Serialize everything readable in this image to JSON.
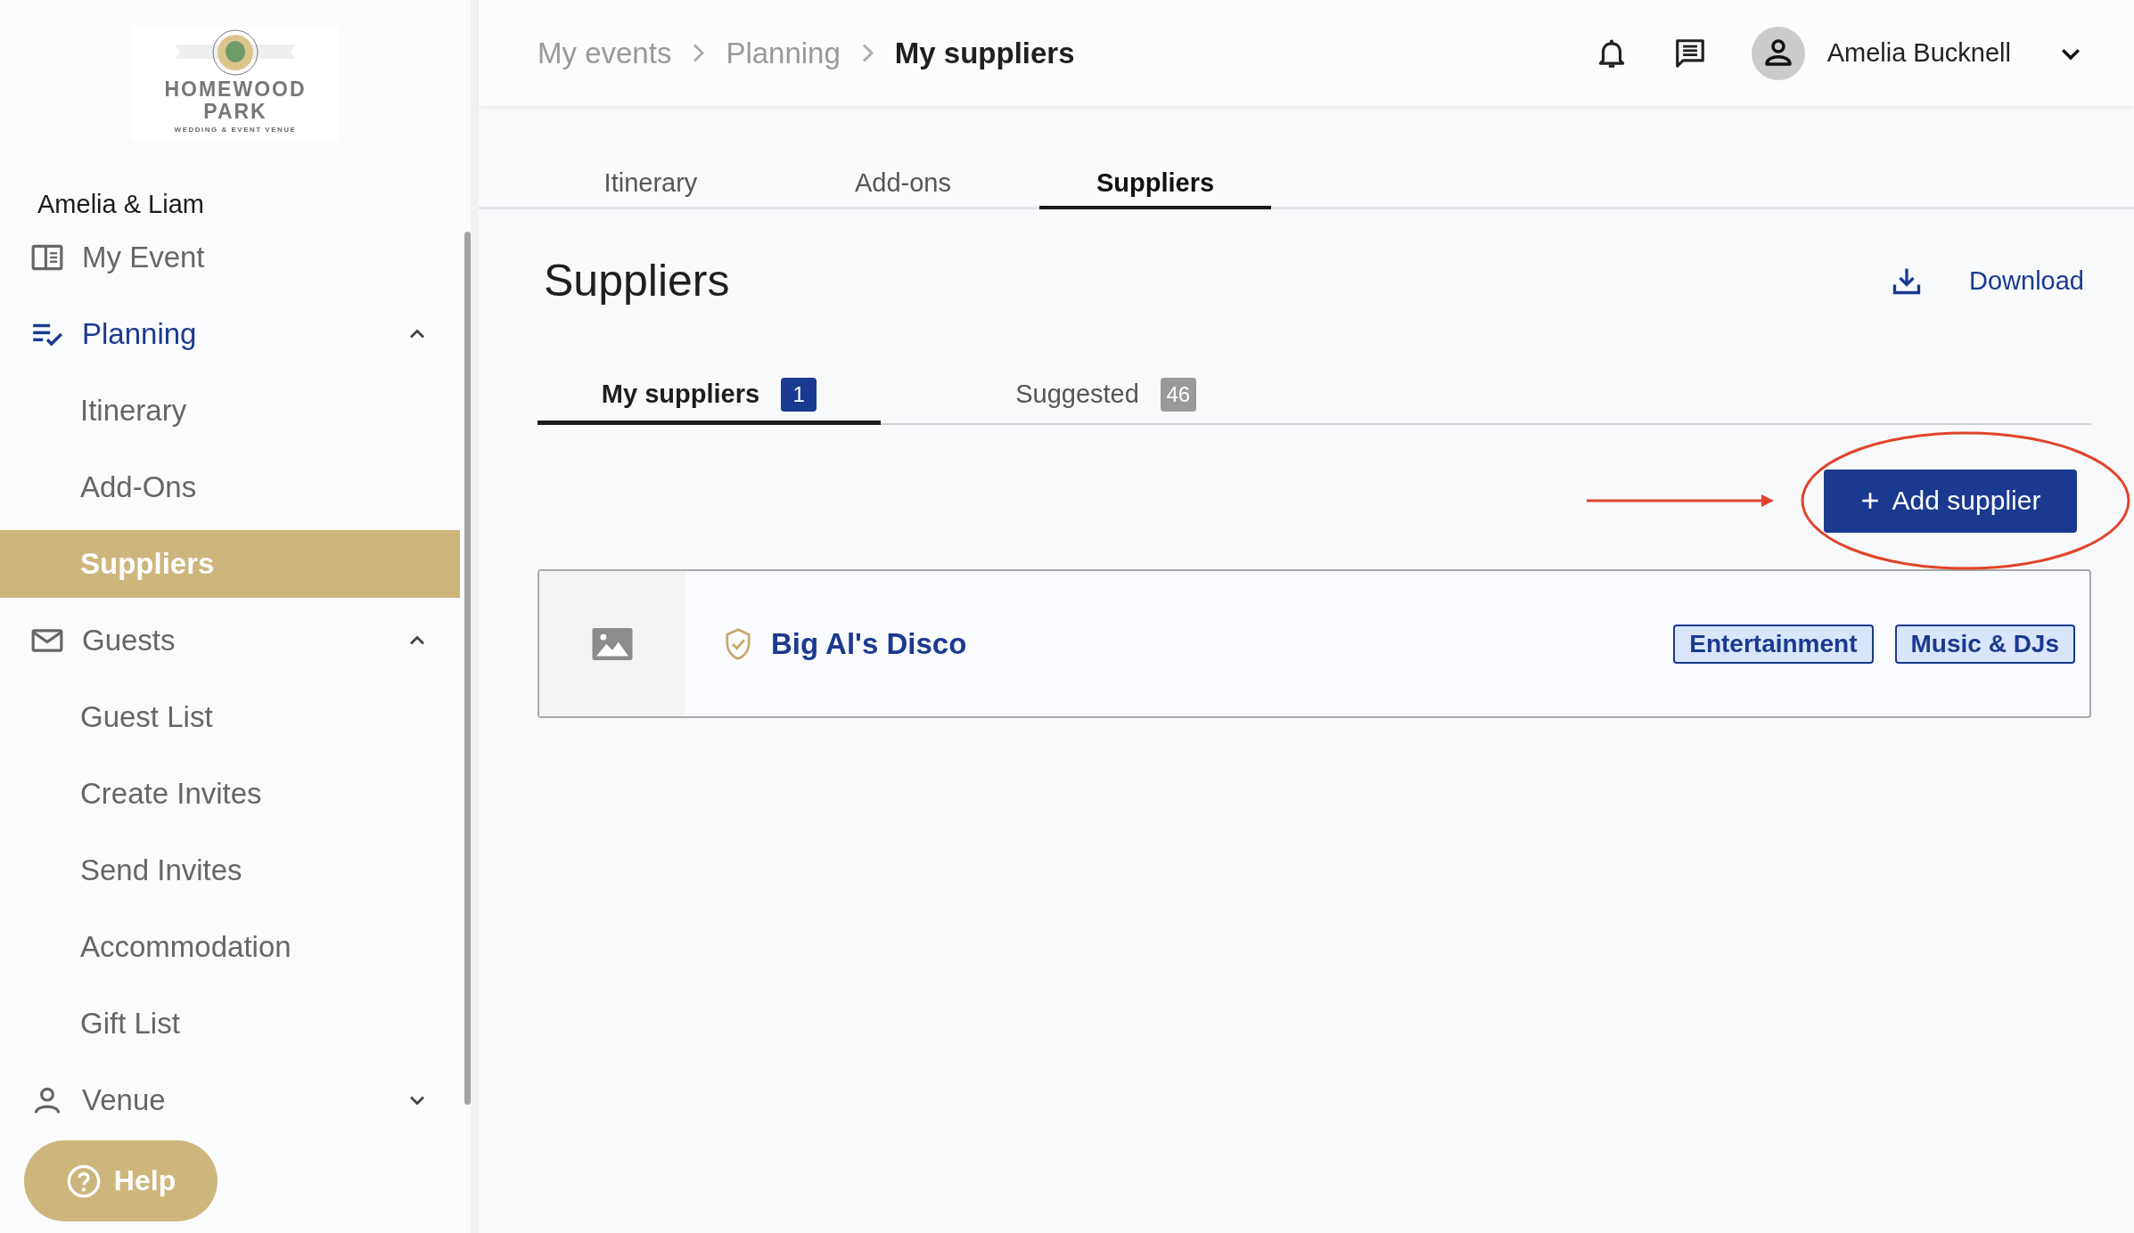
{
  "logo": {
    "name_line_1": "HOMEWOOD",
    "name_line_2": "PARK",
    "tagline": "WEDDING & EVENT VENUE"
  },
  "sidebar": {
    "event_name": "Amelia & Liam",
    "items": [
      {
        "label": "My Event"
      },
      {
        "label": "Planning",
        "expanded": true,
        "children": [
          {
            "label": "Itinerary",
            "selected": false
          },
          {
            "label": "Add-Ons",
            "selected": false
          },
          {
            "label": "Suppliers",
            "selected": true
          }
        ]
      },
      {
        "label": "Guests",
        "expanded": true,
        "children": [
          {
            "label": "Guest List",
            "selected": false
          },
          {
            "label": "Create Invites",
            "selected": false
          },
          {
            "label": "Send Invites",
            "selected": false
          },
          {
            "label": "Accommodation",
            "selected": false
          },
          {
            "label": "Gift List",
            "selected": false
          }
        ]
      },
      {
        "label": "Venue",
        "expanded": false
      }
    ]
  },
  "help_button": "Help",
  "breadcrumbs": [
    "My events",
    "Planning",
    "My suppliers"
  ],
  "user": {
    "name": "Amelia Bucknell"
  },
  "tabs": [
    {
      "label": "Itinerary",
      "selected": false
    },
    {
      "label": "Add-ons",
      "selected": false
    },
    {
      "label": "Suppliers",
      "selected": true
    }
  ],
  "page_title": "Suppliers",
  "download": "Download",
  "subtabs": [
    {
      "label": "My suppliers",
      "count": "1",
      "selected": true
    },
    {
      "label": "Suggested",
      "count": "46",
      "selected": false
    }
  ],
  "add_button": "Add supplier",
  "suppliers": [
    {
      "name": "Big Al's Disco",
      "verified": true,
      "tags": [
        "Entertainment",
        "Music & DJs"
      ]
    }
  ]
}
